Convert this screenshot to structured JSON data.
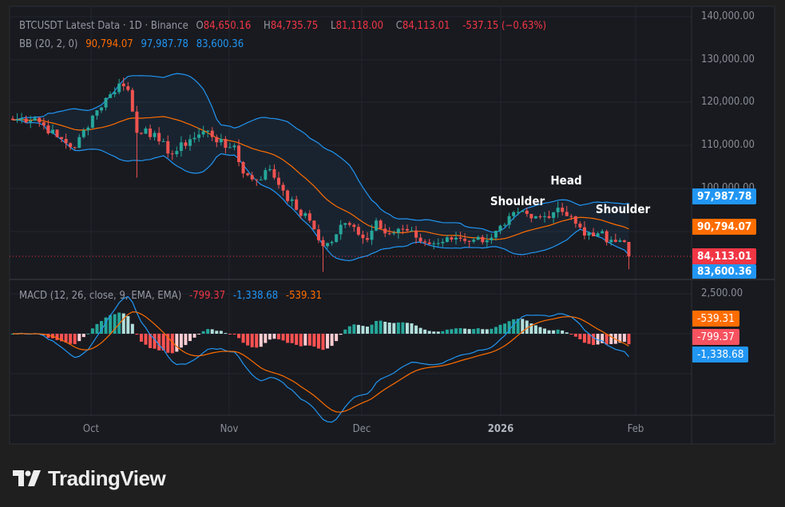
{
  "header": {
    "symbol": "BTCUSDT Latest Data · 1D · Binance",
    "open_label": "O",
    "open": "84,650.16",
    "high_label": "H",
    "high": "84,735.75",
    "low_label": "L",
    "low": "81,118.00",
    "close_label": "C",
    "close": "84,113.01",
    "change": "-537.15 (−0.63%)",
    "bb_label": "BB (20, 2, 0)",
    "bb_basis": "90,794.07",
    "bb_upper": "97,987.78",
    "bb_lower": "83,600.36",
    "macd_label": "MACD (12, 26, close, 9, EMA, EMA)",
    "macd_hist": "-799.37",
    "macd_line": "-1,338.68",
    "macd_signal": "-539.31"
  },
  "price_axis": [
    "140,000.00",
    "130,000.00",
    "120,000.00",
    "110,000.00",
    "100,000.00"
  ],
  "macd_axis": [
    "2,500.00"
  ],
  "tags": {
    "bb_upper": "97,987.78",
    "bb_basis": "90,794.07",
    "last_price": "84,113.01",
    "bb_lower": "83,600.36",
    "macd_signal": "-539.31",
    "macd_hist": "-799.37",
    "macd_line": "-1,338.68"
  },
  "time_axis": [
    "Oct",
    "Nov",
    "Dec",
    "2026",
    "Feb"
  ],
  "annotations": {
    "left": "Shoulder",
    "head": "Head",
    "right": "Shoulder"
  },
  "brand": "TradingView",
  "colors": {
    "up": "#26a69a",
    "down": "#ef5350",
    "bb": "#2196f3",
    "basis": "#ff6d00",
    "macd": "#2196f3",
    "signal": "#ff6d00"
  },
  "chart_data": {
    "type": "candlestick",
    "title": "BTCUSDT Latest Data · 1D · Binance",
    "x_unit": "days since 2025-09-12",
    "ylim": [
      78000,
      142000
    ],
    "close_keypoints": [
      [
        0,
        116000
      ],
      [
        5,
        116500
      ],
      [
        10,
        112000
      ],
      [
        14,
        109500
      ],
      [
        18,
        117000
      ],
      [
        22,
        122000
      ],
      [
        24,
        124500
      ],
      [
        26,
        123000
      ],
      [
        28,
        113000
      ],
      [
        30,
        114000
      ],
      [
        33,
        111000
      ],
      [
        36,
        108000
      ],
      [
        40,
        111500
      ],
      [
        44,
        113500
      ],
      [
        48,
        109500
      ],
      [
        50,
        110000
      ],
      [
        52,
        103500
      ],
      [
        55,
        102000
      ],
      [
        58,
        104500
      ],
      [
        61,
        99500
      ],
      [
        64,
        95000
      ],
      [
        67,
        92500
      ],
      [
        70,
        86500
      ],
      [
        72,
        87500
      ],
      [
        74,
        91500
      ],
      [
        77,
        91000
      ],
      [
        80,
        88000
      ],
      [
        82,
        92500
      ],
      [
        85,
        89500
      ],
      [
        88,
        90500
      ],
      [
        91,
        88500
      ],
      [
        94,
        87000
      ],
      [
        97,
        87500
      ],
      [
        100,
        88500
      ],
      [
        104,
        88000
      ],
      [
        108,
        88500
      ],
      [
        111,
        91500
      ],
      [
        114,
        94500
      ],
      [
        117,
        93000
      ],
      [
        120,
        93500
      ],
      [
        123,
        95500
      ],
      [
        126,
        93500
      ],
      [
        129,
        89000
      ],
      [
        132,
        89500
      ],
      [
        135,
        88000
      ],
      [
        138,
        87500
      ],
      [
        139,
        84113.01
      ]
    ],
    "indicators": [
      "Bollinger Bands (20, 2)",
      "MACD (12, 26, 9)"
    ],
    "pattern": "Head and Shoulders"
  }
}
